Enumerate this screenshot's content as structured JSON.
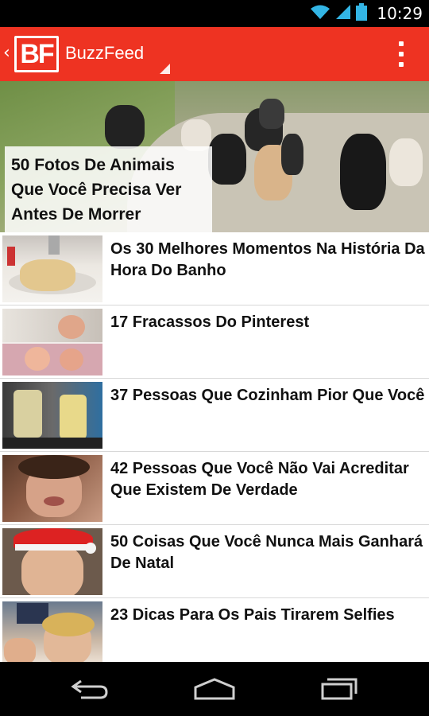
{
  "status_bar": {
    "time": "10:29",
    "icons": [
      "wifi-icon",
      "signal-icon",
      "battery-icon"
    ]
  },
  "app_bar": {
    "logo_text": "BF",
    "title": "BuzzFeed",
    "icons": [
      "back-chevron-icon",
      "dropdown-indicator-icon",
      "overflow-menu-icon"
    ],
    "color": "#ee3322"
  },
  "hero": {
    "title": "50 Fotos De Animais Que Você Precisa Ver Antes De Morrer"
  },
  "articles": [
    {
      "title": "Os 30 Melhores Momentos Na História Da Hora Do Banho"
    },
    {
      "title": "17 Fracassos Do Pinterest"
    },
    {
      "title": "37 Pessoas Que Cozinham Pior Que Você"
    },
    {
      "title": "42 Pessoas Que Você Não Vai Acreditar Que Existem De Verdade"
    },
    {
      "title": "50 Coisas Que Você Nunca Mais Ganhará De Natal"
    },
    {
      "title": "23 Dicas Para Os Pais Tirarem Selfies"
    }
  ],
  "nav_bar": {
    "icons": [
      "back-icon",
      "home-icon",
      "recent-apps-icon"
    ]
  }
}
